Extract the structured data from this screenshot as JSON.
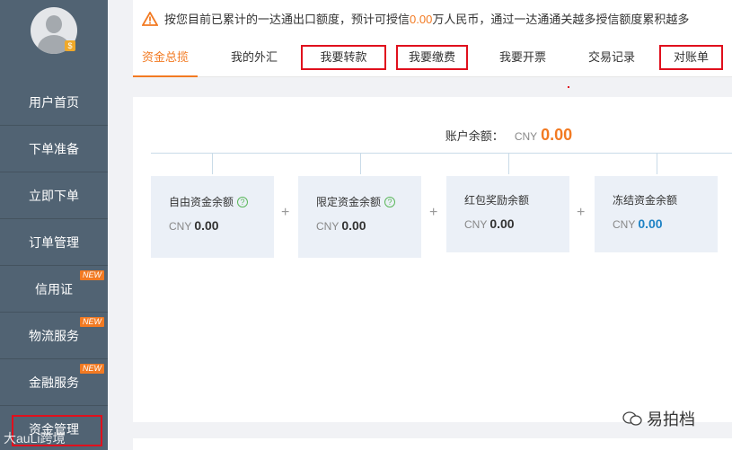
{
  "sidebar": {
    "vip_badge": "$",
    "items": [
      {
        "label": "用户首页",
        "new": ""
      },
      {
        "label": "下单准备",
        "new": ""
      },
      {
        "label": "立即下单",
        "new": ""
      },
      {
        "label": "订单管理",
        "new": ""
      },
      {
        "label": "信用证",
        "new": "NEW"
      },
      {
        "label": "物流服务",
        "new": "NEW"
      },
      {
        "label": "金融服务",
        "new": "NEW"
      },
      {
        "label": "资金管理",
        "new": ""
      }
    ]
  },
  "notice": {
    "prefix": "按您目前已累计的一达通出口额度，预计可授信",
    "amount": "0.00",
    "suffix": "万人民币，通过一达通通关越多授信额度累积越多"
  },
  "tabs": [
    {
      "label": "资金总揽"
    },
    {
      "label": "我的外汇"
    },
    {
      "label": "我要转款"
    },
    {
      "label": "我要缴费"
    },
    {
      "label": "我要开票"
    },
    {
      "label": "交易记录"
    },
    {
      "label": "对账单"
    }
  ],
  "balance": {
    "label": "账户余额：",
    "currency": "CNY",
    "value": "0.00"
  },
  "cards": [
    {
      "title": "自由资金余额",
      "help": "?",
      "currency": "CNY",
      "value": "0.00"
    },
    {
      "title": "限定资金余额",
      "help": "?",
      "currency": "CNY",
      "value": "0.00"
    },
    {
      "title": "红包奖励余额",
      "help": "",
      "currency": "CNY",
      "value": "0.00"
    },
    {
      "title": "冻结资金余额",
      "help": "",
      "currency": "CNY",
      "value": "0.00"
    }
  ],
  "plus_sign": "+",
  "watermarks": {
    "right": "易拍档",
    "left": "大auLi跨境"
  },
  "colors": {
    "accent": "#f27a22",
    "sidebar": "#516373",
    "highlight_box": "#e0101d",
    "frozen_value": "#1f83c5"
  }
}
